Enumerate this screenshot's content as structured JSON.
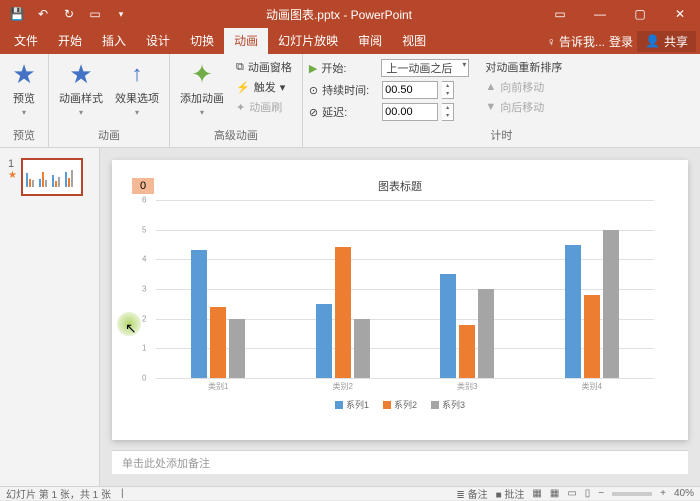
{
  "titlebar": {
    "title": "动画图表.pptx - PowerPoint"
  },
  "menu": {
    "items": [
      "文件",
      "开始",
      "插入",
      "设计",
      "切换",
      "动画",
      "幻灯片放映",
      "审阅",
      "视图"
    ],
    "active": 5,
    "tell_me": "告诉我...",
    "login": "登录",
    "share": "共享"
  },
  "ribbon": {
    "preview": {
      "btn": "预览",
      "group": "预览"
    },
    "anim": {
      "style": "动画样式",
      "effect": "效果选项",
      "group": "动画"
    },
    "adv": {
      "add": "添加动画",
      "pane": "动画窗格",
      "trigger": "触发",
      "painter": "动画刷",
      "group": "高级动画"
    },
    "timing": {
      "start": "开始:",
      "start_val": "上一动画之后",
      "duration": "持续时间:",
      "duration_val": "00.50",
      "delay": "延迟:",
      "delay_val": "00.00",
      "reorder": "对动画重新排序",
      "fwd": "向前移动",
      "back": "向后移动",
      "group": "计时"
    }
  },
  "thumbs": {
    "num": "1"
  },
  "slide": {
    "anim_badge": "0",
    "chart_title": "图表标题",
    "notes_placeholder": "单击此处添加备注"
  },
  "chart_data": {
    "type": "bar",
    "title": "图表标题",
    "categories": [
      "类别1",
      "类别2",
      "类别3",
      "类别4"
    ],
    "series": [
      {
        "name": "系列1",
        "color": "#5b9bd5",
        "values": [
          4.3,
          2.5,
          3.5,
          4.5
        ]
      },
      {
        "name": "系列2",
        "color": "#ed7d31",
        "values": [
          2.4,
          4.4,
          1.8,
          2.8
        ]
      },
      {
        "name": "系列3",
        "color": "#a5a5a5",
        "values": [
          2.0,
          2.0,
          3.0,
          5.0
        ]
      }
    ],
    "ylim": [
      0,
      6
    ],
    "yticks": [
      0,
      1,
      2,
      3,
      4,
      5,
      6
    ],
    "xlabel": "",
    "ylabel": ""
  },
  "status": {
    "slide_info": "幻灯片 第 1 张，共 1 张",
    "notes": "备注",
    "comments": "批注",
    "zoom": "40%"
  },
  "colors": {
    "brand": "#b7472a"
  }
}
